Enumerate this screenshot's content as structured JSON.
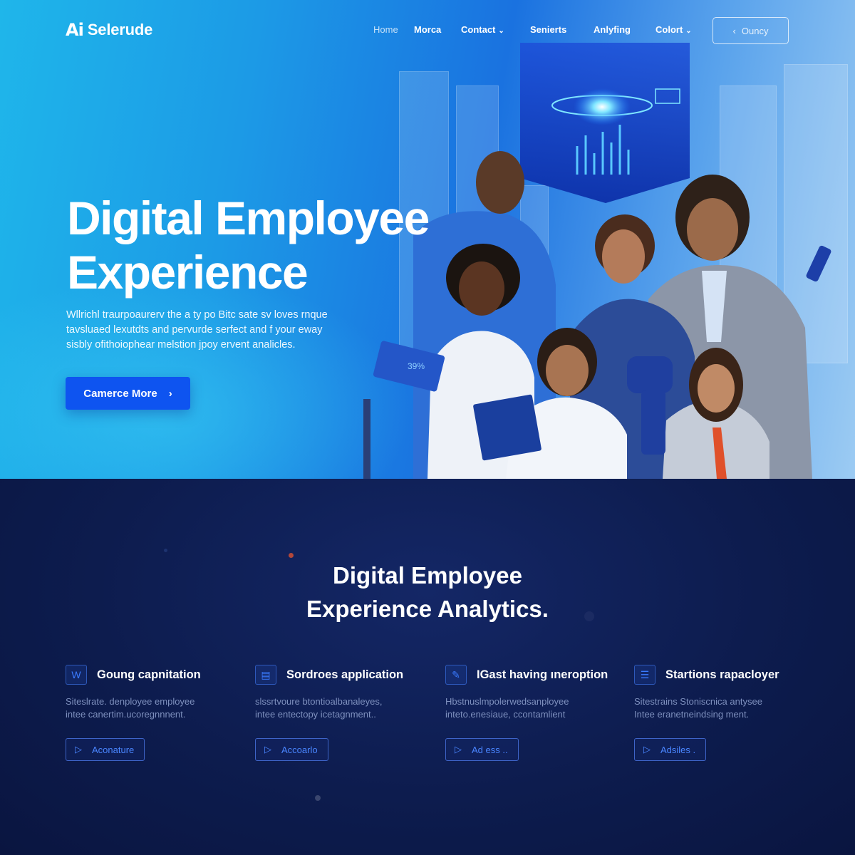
{
  "brand": {
    "mark": "Ai",
    "name": "Selerude"
  },
  "nav": {
    "items": [
      {
        "label": "Home"
      },
      {
        "label": "Morca"
      },
      {
        "label": "Contact",
        "dropdown": true
      },
      {
        "label": "Senierts"
      },
      {
        "label": "Anlyfing"
      },
      {
        "label": "Colort",
        "dropdown": true
      }
    ],
    "query_button": {
      "label": "Ouncy",
      "icon": "chevron-left-icon"
    }
  },
  "hero": {
    "title_line1": "Digital Employee",
    "title_line2": "Experience",
    "body_line1": "Wllrichl traurpoaurerv the a ty po Bitc sate sv loves rnque",
    "body_line2": "tavsluaed lexutdts and pervurde serfect and f your eway",
    "body_line3": "sisbly ofithoiophear melstion jpoy ervent analicles.",
    "cta": {
      "label": "Camerce More",
      "icon": "chevron-right-icon"
    },
    "tablet_text": "39%"
  },
  "analytics": {
    "title_line1": "Digital Employee",
    "title_line2": "Experience Analytics.",
    "features": [
      {
        "icon": "document-icon",
        "icon_glyph": "W",
        "title": "Goung capnitation",
        "desc_line1": "Siteslrate. denployee employee",
        "desc_line2": "intee canertim.ucoregnnnent.",
        "button": "Aconature"
      },
      {
        "icon": "briefcase-icon",
        "icon_glyph": "▤",
        "title": "Sordroes application",
        "desc_line1": "slssrtvoure btontioalbanaleyes,",
        "desc_line2": "intee entectopy icetagnment..",
        "button": "Accoarlo"
      },
      {
        "icon": "pen-icon",
        "icon_glyph": "✎",
        "title": "IGast having ıneroption",
        "desc_line1": "Hbstnuslmpolerwedsanployee",
        "desc_line2": "inteto.enesiaue, ccontamlient",
        "button": "Ad ess .."
      },
      {
        "icon": "list-icon",
        "icon_glyph": "☰",
        "title": "Startions rapacloyer",
        "desc_line1": "Sitestrains Stoniscnica antysee",
        "desc_line2": "Intee eranetneindsing ment.",
        "button": "Adsiles ."
      }
    ]
  },
  "colors": {
    "accent": "#0e54f0",
    "hero_cyan": "#1fb6ea",
    "hero_blue": "#1a72e0",
    "dark_bg": "#0d1c4e",
    "feature_link": "#4a86ff"
  }
}
